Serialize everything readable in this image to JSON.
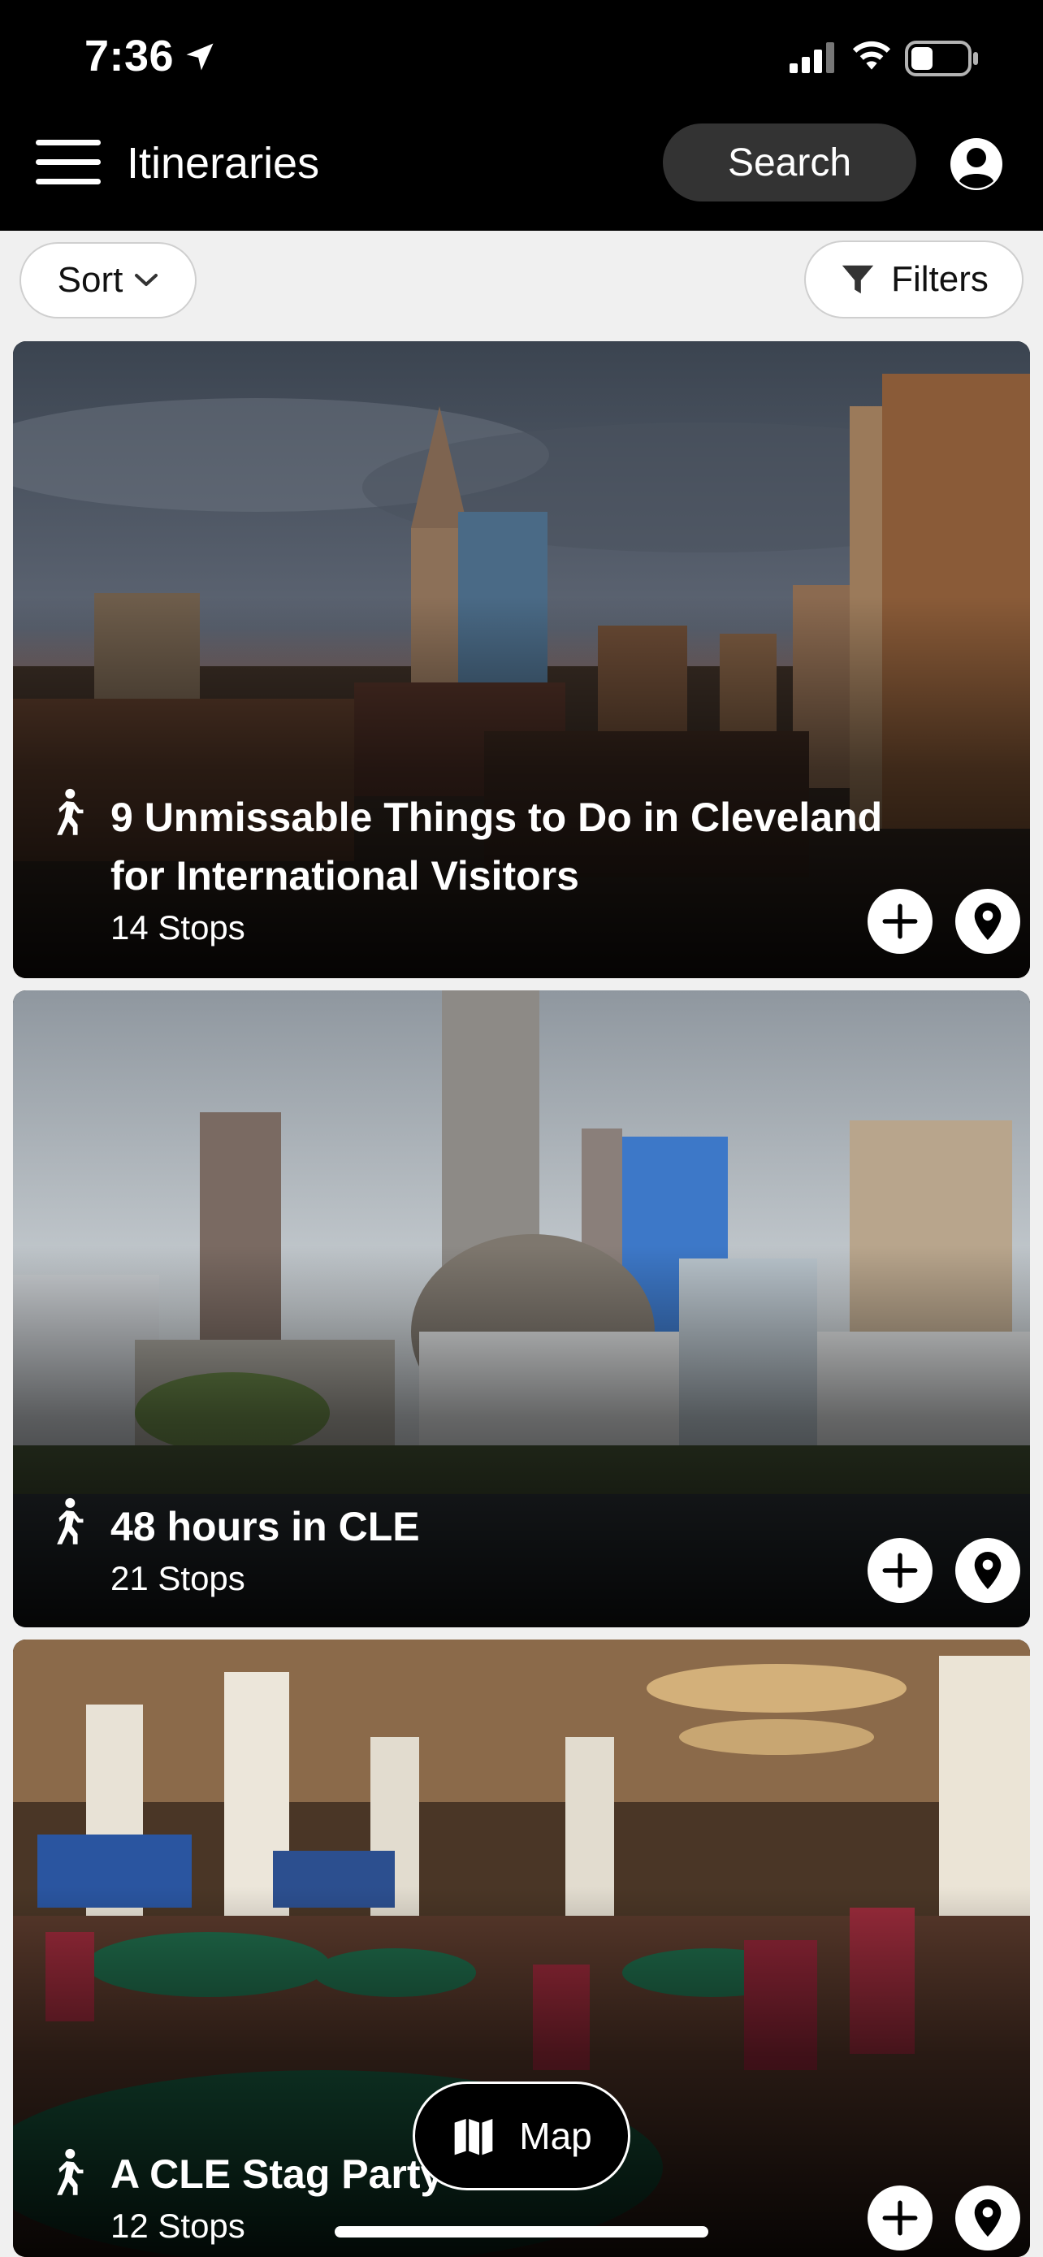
{
  "status_bar": {
    "time": "7:36",
    "icons": [
      "location-arrow-icon",
      "signal-icon",
      "wifi-icon",
      "battery-icon"
    ]
  },
  "header": {
    "title": "Itineraries",
    "search_label": "Search",
    "menu_icon": "hamburger-menu-icon",
    "profile_icon": "user-avatar-icon"
  },
  "filter_bar": {
    "sort_label": "Sort",
    "filters_label": "Filters"
  },
  "itineraries": [
    {
      "title_line1": "9 Unmissable Things to Do in Cleveland",
      "title_line2": "for International Visitors",
      "stops": "14 Stops",
      "image": "cleveland skyline at sunset"
    },
    {
      "title_line1": "48 hours in CLE",
      "stops": "21 Stops",
      "image": "cleveland waterfront skyline"
    },
    {
      "title_line1": "A CLE Stag Party",
      "stops": "12 Stops",
      "image": "casino floor"
    }
  ],
  "map_button": {
    "label": "Map",
    "icon": "map-icon"
  },
  "colors": {
    "header_bg": "#000000",
    "page_bg": "#f0f0f0",
    "pill_bg": "#333333"
  }
}
